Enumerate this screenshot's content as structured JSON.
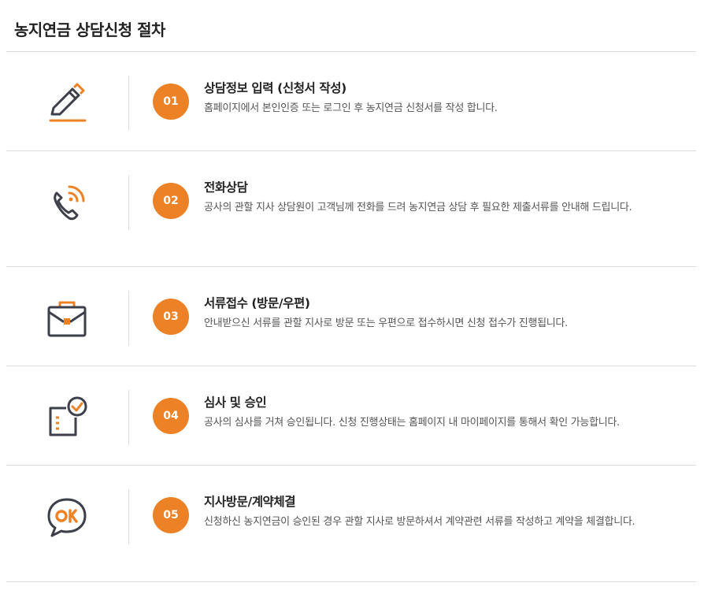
{
  "page": {
    "title": "농지연금 상담신청 절차"
  },
  "colors": {
    "accent": "#ec8126",
    "icon_stroke": "#3d3f4a",
    "divider": "#dddddd"
  },
  "steps": [
    {
      "number": "01",
      "icon": "pencil-write-icon",
      "title": "상담정보 입력 (신청서 작성)",
      "desc": "홈페이지에서 본인인증 또는 로그인 후 농지연금 신청서를 작성 합니다."
    },
    {
      "number": "02",
      "icon": "phone-call-icon",
      "title": "전화상담",
      "desc": "공사의 관할 지사 상담원이 고객님께 전화를 드려 농지연금 상담 후 필요한 제출서류를 안내해 드립니다."
    },
    {
      "number": "03",
      "icon": "briefcase-icon",
      "title": "서류접수 (방문/우편)",
      "desc": "안내받으신 서류를 관할 지사로 방문 또는 우편으로 접수하시면 신청 접수가 진행됩니다."
    },
    {
      "number": "04",
      "icon": "document-check-icon",
      "title": "심사 및 승인",
      "desc": "공사의 심사를 거쳐 승인됩니다. 신청 진행상태는 홈페이지 내 마이페이지를 통해서 확인 가능합니다."
    },
    {
      "number": "05",
      "icon": "ok-speech-bubble-icon",
      "title": "지사방문/계약체결",
      "desc": "신청하신 농지연금이 승인된 경우 관할 지사로 방문하셔서 계약관련 서류를 작성하고 계약을 체결합니다."
    }
  ]
}
